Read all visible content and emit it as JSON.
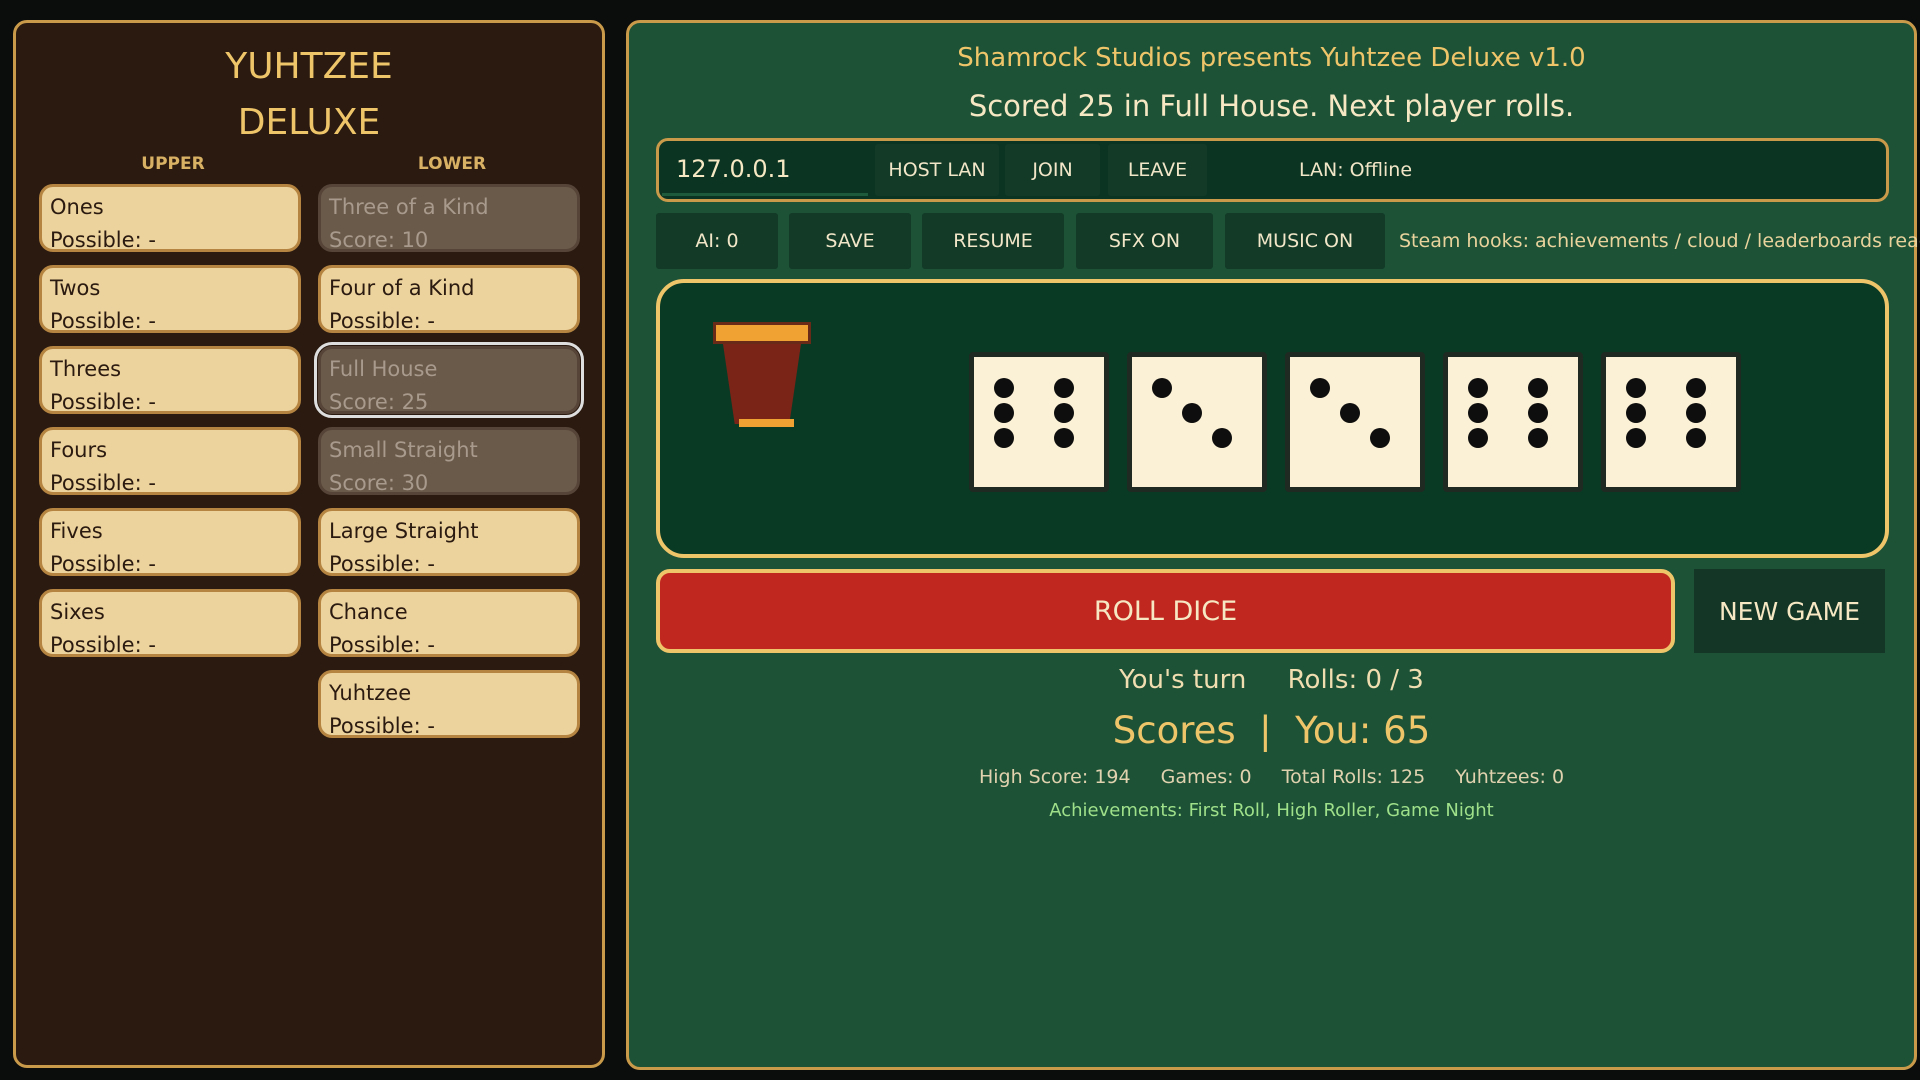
{
  "app": {
    "title_line1": "YUHTZEE",
    "title_line2": "DELUXE",
    "credit": "Shamrock Studios presents Yuhtzee Deluxe v1.0",
    "status_message": "Scored 25 in Full House. Next player rolls."
  },
  "scorecard": {
    "upper_header": "UPPER",
    "lower_header": "LOWER",
    "upper": [
      {
        "name": "Ones",
        "value": "Possible: -"
      },
      {
        "name": "Twos",
        "value": "Possible: -"
      },
      {
        "name": "Threes",
        "value": "Possible: -"
      },
      {
        "name": "Fours",
        "value": "Possible: -"
      },
      {
        "name": "Fives",
        "value": "Possible: -"
      },
      {
        "name": "Sixes",
        "value": "Possible: -"
      }
    ],
    "lower": [
      {
        "name": "Three of a Kind",
        "value": "Score: 10",
        "used": true
      },
      {
        "name": "Four of a Kind",
        "value": "Possible: -"
      },
      {
        "name": "Full House",
        "value": "Score: 25",
        "used": true,
        "selected": true
      },
      {
        "name": "Small Straight",
        "value": "Score: 30",
        "used": true
      },
      {
        "name": "Large Straight",
        "value": "Possible: -"
      },
      {
        "name": "Chance",
        "value": "Possible: -"
      },
      {
        "name": "Yuhtzee",
        "value": "Possible: -"
      }
    ]
  },
  "lan": {
    "ip_value": "127.0.0.1",
    "host_label": "HOST LAN",
    "join_label": "JOIN",
    "leave_label": "LEAVE",
    "status": "LAN: Offline"
  },
  "options": {
    "ai_label": "AI: 0",
    "save_label": "SAVE",
    "resume_label": "RESUME",
    "sfx_label": "SFX ON",
    "music_label": "MUSIC ON",
    "steam_text": "Steam hooks: achievements / cloud / leaderboards ready"
  },
  "dice": [
    6,
    3,
    3,
    6,
    6
  ],
  "controls": {
    "roll_label": "ROLL DICE",
    "new_game_label": "NEW GAME"
  },
  "turn": {
    "player": "You's turn",
    "rolls": "Rolls: 0 / 3"
  },
  "scores": {
    "label": "Scores",
    "you": "You: 65"
  },
  "stats": {
    "high_score": "High Score: 194",
    "games": "Games: 0",
    "total_rolls": "Total Rolls: 125",
    "yuhtzees": "Yuhtzees: 0"
  },
  "achievements": "Achievements: First Roll, High Roller, Game Night",
  "colors": {
    "accent": "#efc56a",
    "felt": "#1d5237",
    "wood": "#2a1a10",
    "roll_button": "#c0281f"
  }
}
